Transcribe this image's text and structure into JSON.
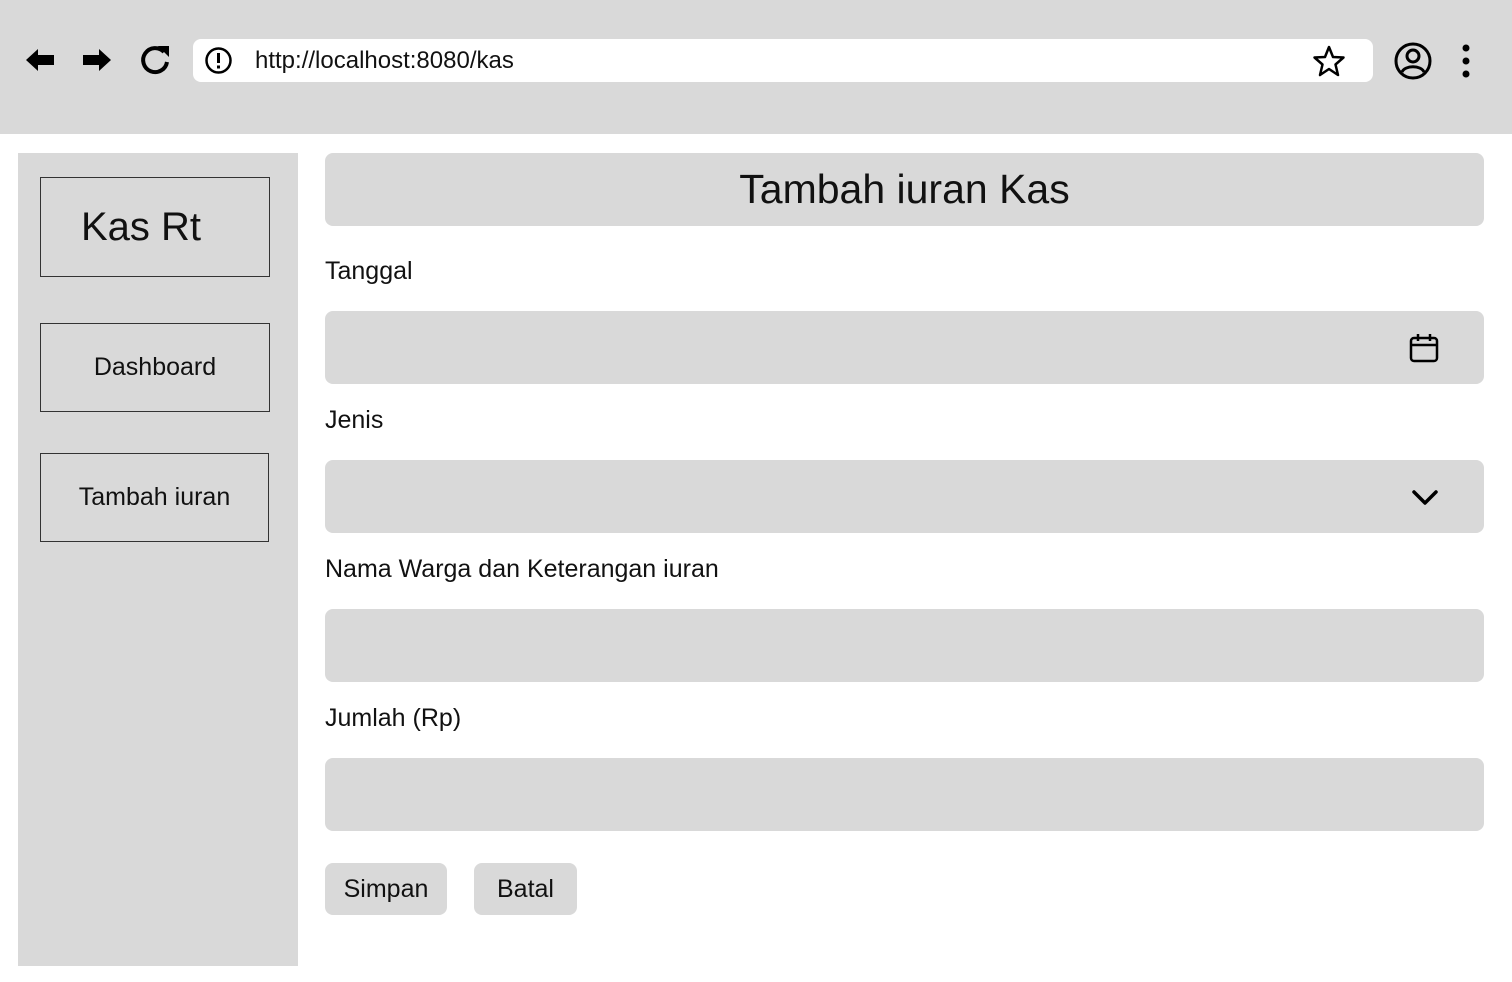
{
  "browser": {
    "url": "http://localhost:8080/kas",
    "icons": [
      "back-arrow-icon",
      "forward-arrow-icon",
      "reload-icon",
      "site-info-icon",
      "bookmark-star-icon",
      "profile-icon",
      "more-vert-icon"
    ]
  },
  "sidebar": {
    "brand": "Kas Rt",
    "items": [
      {
        "label": "Dashboard"
      },
      {
        "label": "Tambah iuran"
      }
    ]
  },
  "form": {
    "title": "Tambah iuran Kas",
    "fields": [
      {
        "label": "Tanggal",
        "value": "",
        "icon": "calendar-icon"
      },
      {
        "label": "Jenis",
        "value": "",
        "icon": "chevron-down-icon"
      },
      {
        "label": "Nama Warga dan Keterangan iuran",
        "value": ""
      },
      {
        "label": "Jumlah (Rp)",
        "value": ""
      }
    ],
    "save_label": "Simpan",
    "cancel_label": "Batal"
  }
}
